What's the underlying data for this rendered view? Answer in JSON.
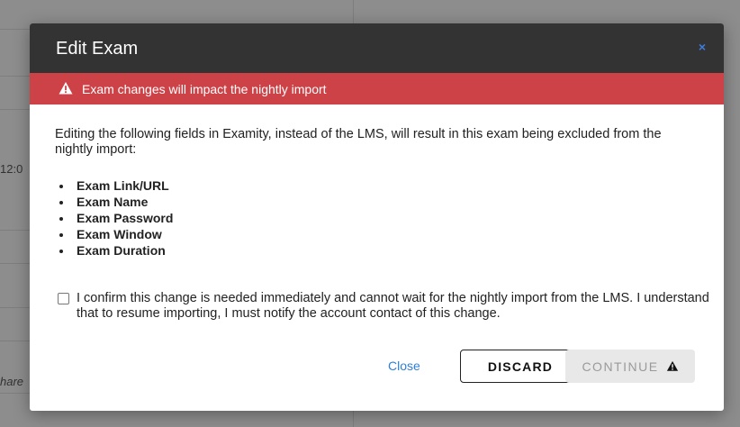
{
  "background": {
    "fragments": [
      "12:0",
      "hare"
    ]
  },
  "modal": {
    "title": "Edit Exam",
    "close_icon": "×",
    "warning": {
      "icon": "warning-triangle-icon",
      "text": "Exam changes will impact the nightly import",
      "color": "#cc4247"
    },
    "intro": "Editing the following fields in Examity, instead of the LMS, will result in this exam being excluded from the nightly import:",
    "fields": [
      "Exam Link/URL",
      "Exam Name",
      "Exam Password",
      "Exam Window",
      "Exam Duration"
    ],
    "confirm": {
      "checked": false,
      "text": "I confirm this change is needed immediately and cannot wait for the nightly import from the LMS. I understand that to resume importing, I must notify the account contact of this change."
    },
    "footer": {
      "close_label": "Close",
      "discard_label": "DISCARD",
      "continue_label": "CONTINUE"
    }
  },
  "colors": {
    "header_bg": "#333333",
    "link": "#2f7ed8",
    "warning_bg": "#cc4247"
  }
}
